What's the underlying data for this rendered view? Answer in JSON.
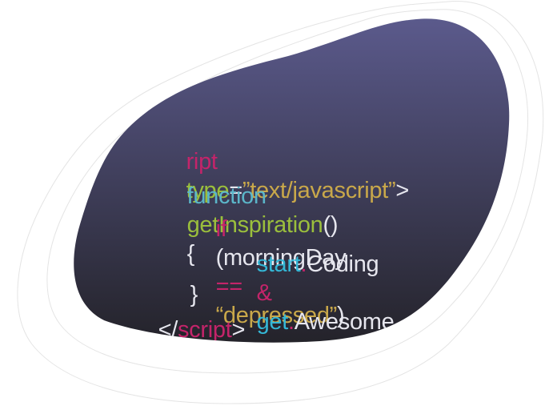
{
  "colors": {
    "background": "#ffffff",
    "blob_top": "#5b5a8c",
    "blob_bottom": "#24232a",
    "outline": "#e4e4e4",
    "tag": "#c4246a",
    "attribute": "#9bbf3c",
    "string": "#c9a84a",
    "function_keyword": "#5bb6c9",
    "function_name": "#9bbf3c",
    "plain": "#e6e6ee",
    "control_keyword": "#c4246a",
    "operator": "#c4246a",
    "object": "#34b7d6"
  },
  "code": {
    "line1": {
      "tag_fragment": "ript",
      "attr_name": "type",
      "equals": "=",
      "attr_value": "”text/javascript”",
      "close": ">"
    },
    "line2": {
      "keyword": "function",
      "name": "getInspiration",
      "parens": "()",
      "brace": "{"
    },
    "line3": {
      "keyword": "if",
      "open_paren": "(",
      "variable": "morningDay",
      "operator": "==",
      "string": "“depressed”",
      "close_paren": ")"
    },
    "line4": {
      "obj1": "start",
      "dot1": ".",
      "method1": "Coding",
      "amp": "&",
      "obj2": "get",
      "dot2": ".",
      "method2": "Awesome"
    },
    "line5": {
      "brace": "}"
    },
    "line6": {
      "open": "</",
      "tag": "script",
      "close": ">"
    }
  }
}
